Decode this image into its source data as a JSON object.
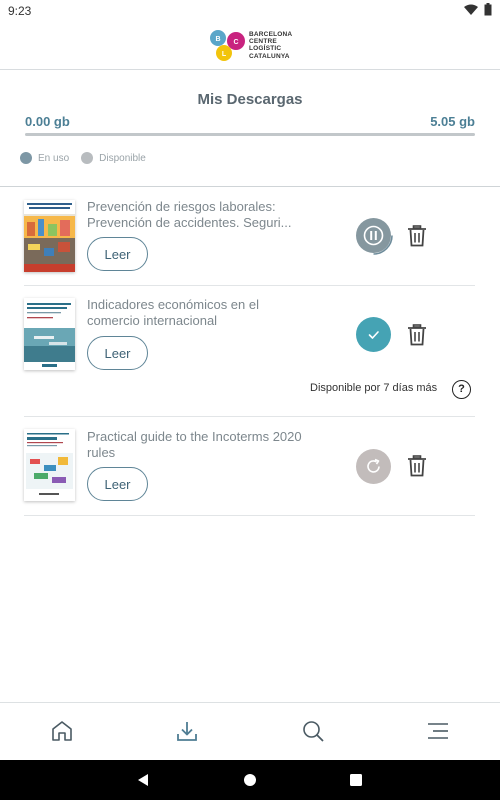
{
  "status_bar": {
    "time": "9:23"
  },
  "header": {
    "logo_lines": [
      "BARCELONA",
      "CENTRE",
      "LOGÍSTIC",
      "CATALUNYA"
    ],
    "logo_letters": [
      "B",
      "C",
      "L"
    ]
  },
  "storage": {
    "title": "Mis Descargas",
    "used": "0.00 gb",
    "total": "5.05 gb",
    "used_fraction": 0.0,
    "legend": {
      "in_use": "En uso",
      "available": "Disponible"
    },
    "colors": {
      "in_use": "#7d97a5",
      "available": "#b8bcbf"
    }
  },
  "books": [
    {
      "title": "Prevención de riesgos laborales: Prevención de accidentes. Seguri...",
      "read_label": "Leer",
      "status": "downloading",
      "status_icon": "pause-icon"
    },
    {
      "title": "Indicadores económicos en el comercio internacional",
      "read_label": "Leer",
      "status": "downloaded",
      "status_icon": "check-icon",
      "availability": "Disponible por 7 días más",
      "help": "?"
    },
    {
      "title": "Practical guide to the Incoterms 2020 rules",
      "read_label": "Leer",
      "status": "not-downloaded",
      "status_icon": "refresh-icon"
    }
  ],
  "bottom_nav": {
    "items": [
      "home-icon",
      "download-icon",
      "search-icon",
      "menu-icon"
    ],
    "active": "download-icon",
    "active_color": "#4f7d93"
  }
}
